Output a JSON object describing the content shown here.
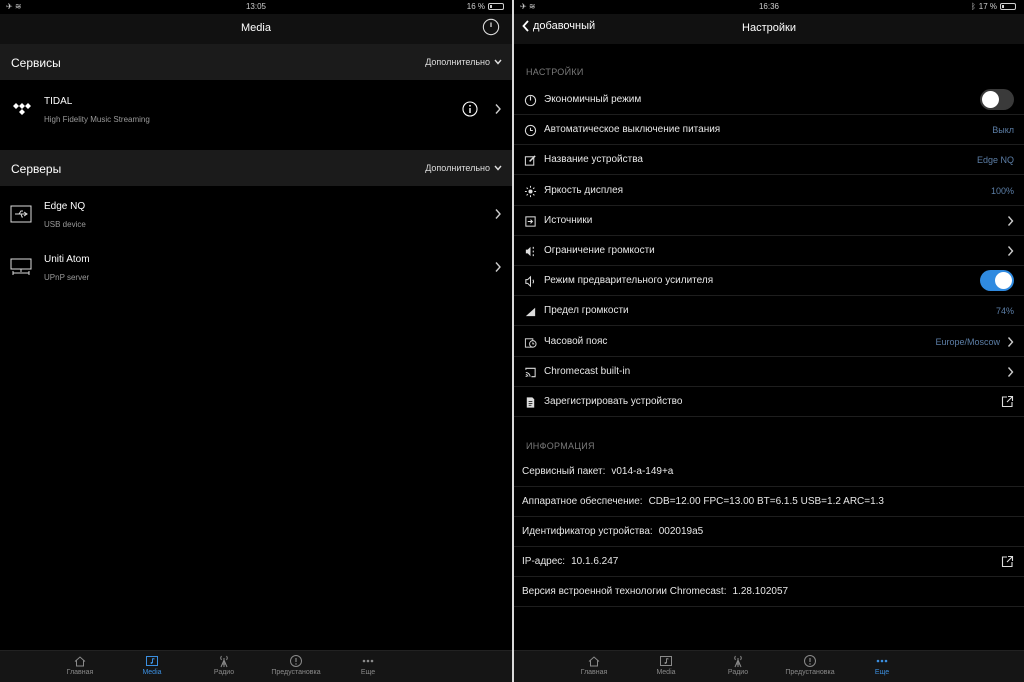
{
  "left": {
    "status": {
      "time": "13:05",
      "battery": "16 %",
      "battery_level": 0.16
    },
    "nav_title": "Media",
    "sections": [
      {
        "name": "Сервисы",
        "more_label": "Дополнительно",
        "items": [
          {
            "title": "TIDAL",
            "subtitle": "High Fidelity Music Streaming",
            "icon": "tidal-icon",
            "has_info": true
          }
        ]
      },
      {
        "name": "Серверы",
        "more_label": "Дополнительно",
        "items": [
          {
            "title": "Edge NQ",
            "subtitle": "USB device",
            "icon": "usb-icon"
          },
          {
            "title": "Uniti Atom",
            "subtitle": "UPnP server",
            "icon": "network-server-icon"
          }
        ]
      }
    ],
    "tabs": [
      {
        "label": "Главная",
        "icon": "home-icon",
        "active": false
      },
      {
        "label": "Media",
        "icon": "media-icon",
        "active": true
      },
      {
        "label": "Радио",
        "icon": "radio-tower-icon",
        "active": false
      },
      {
        "label": "Предустановка",
        "icon": "preset-icon",
        "active": false
      },
      {
        "label": "Еще",
        "icon": "more-icon",
        "active": false
      }
    ]
  },
  "right": {
    "status": {
      "time": "16:36",
      "battery": "17 %",
      "battery_level": 0.17
    },
    "back_label": "добавочный",
    "nav_title": "Настройки",
    "settings_header": "НАСТРОЙКИ",
    "settings": [
      {
        "label": "Экономичный режим",
        "icon": "power-icon",
        "control": "toggle",
        "on": false
      },
      {
        "label": "Автоматическое выключение питания",
        "icon": "clock-icon",
        "value": "Выкл"
      },
      {
        "label": "Название устройства",
        "icon": "edit-icon",
        "value": "Edge NQ"
      },
      {
        "label": "Яркость дисплея",
        "icon": "brightness-icon",
        "value": "100%"
      },
      {
        "label": "Источники",
        "icon": "input-icon",
        "control": "chevron"
      },
      {
        "label": "Ограничение громкости",
        "icon": "volume-limit-icon",
        "control": "chevron"
      },
      {
        "label": "Режим предварительного усилителя",
        "icon": "speaker-icon",
        "control": "toggle",
        "on": true
      },
      {
        "label": "Предел громкости",
        "icon": "volume-ramp-icon",
        "value": "74%"
      },
      {
        "label": "Часовой пояс",
        "icon": "timezone-icon",
        "value": "Europe/Moscow",
        "control": "chevron"
      },
      {
        "label": "Chromecast built-in",
        "icon": "cast-icon",
        "control": "chevron"
      },
      {
        "label": "Зарегистрировать устройство",
        "icon": "document-icon",
        "control": "external"
      }
    ],
    "info_header": "ИНФОРМАЦИЯ",
    "info": [
      {
        "label": "Сервисный пакет:",
        "value": "v014-a-149+a"
      },
      {
        "label": "Аппаратное обеспечение:",
        "value": "CDB=12.00 FPC=13.00 BT=6.1.5 USB=1.2 ARC=1.3"
      },
      {
        "label": "Идентификатор устройства:",
        "value": "002019a5"
      },
      {
        "label": "IP-адрес:",
        "value": "10.1.6.247",
        "external": true
      },
      {
        "label": "Версия встроенной технологии Chromecast:",
        "value": "1.28.102057"
      }
    ],
    "tabs": [
      {
        "label": "Главная",
        "icon": "home-icon",
        "active": false
      },
      {
        "label": "Media",
        "icon": "media-icon",
        "active": false
      },
      {
        "label": "Радио",
        "icon": "radio-tower-icon",
        "active": false
      },
      {
        "label": "Предустановка",
        "icon": "preset-icon",
        "active": false
      },
      {
        "label": "Еще",
        "icon": "more-icon",
        "active": true
      }
    ]
  },
  "colors": {
    "accent": "#3b8fe0",
    "toggle_on": "#2f8ae0",
    "value_text": "#5c7ea6",
    "section_bg": "#1b1b1b"
  }
}
